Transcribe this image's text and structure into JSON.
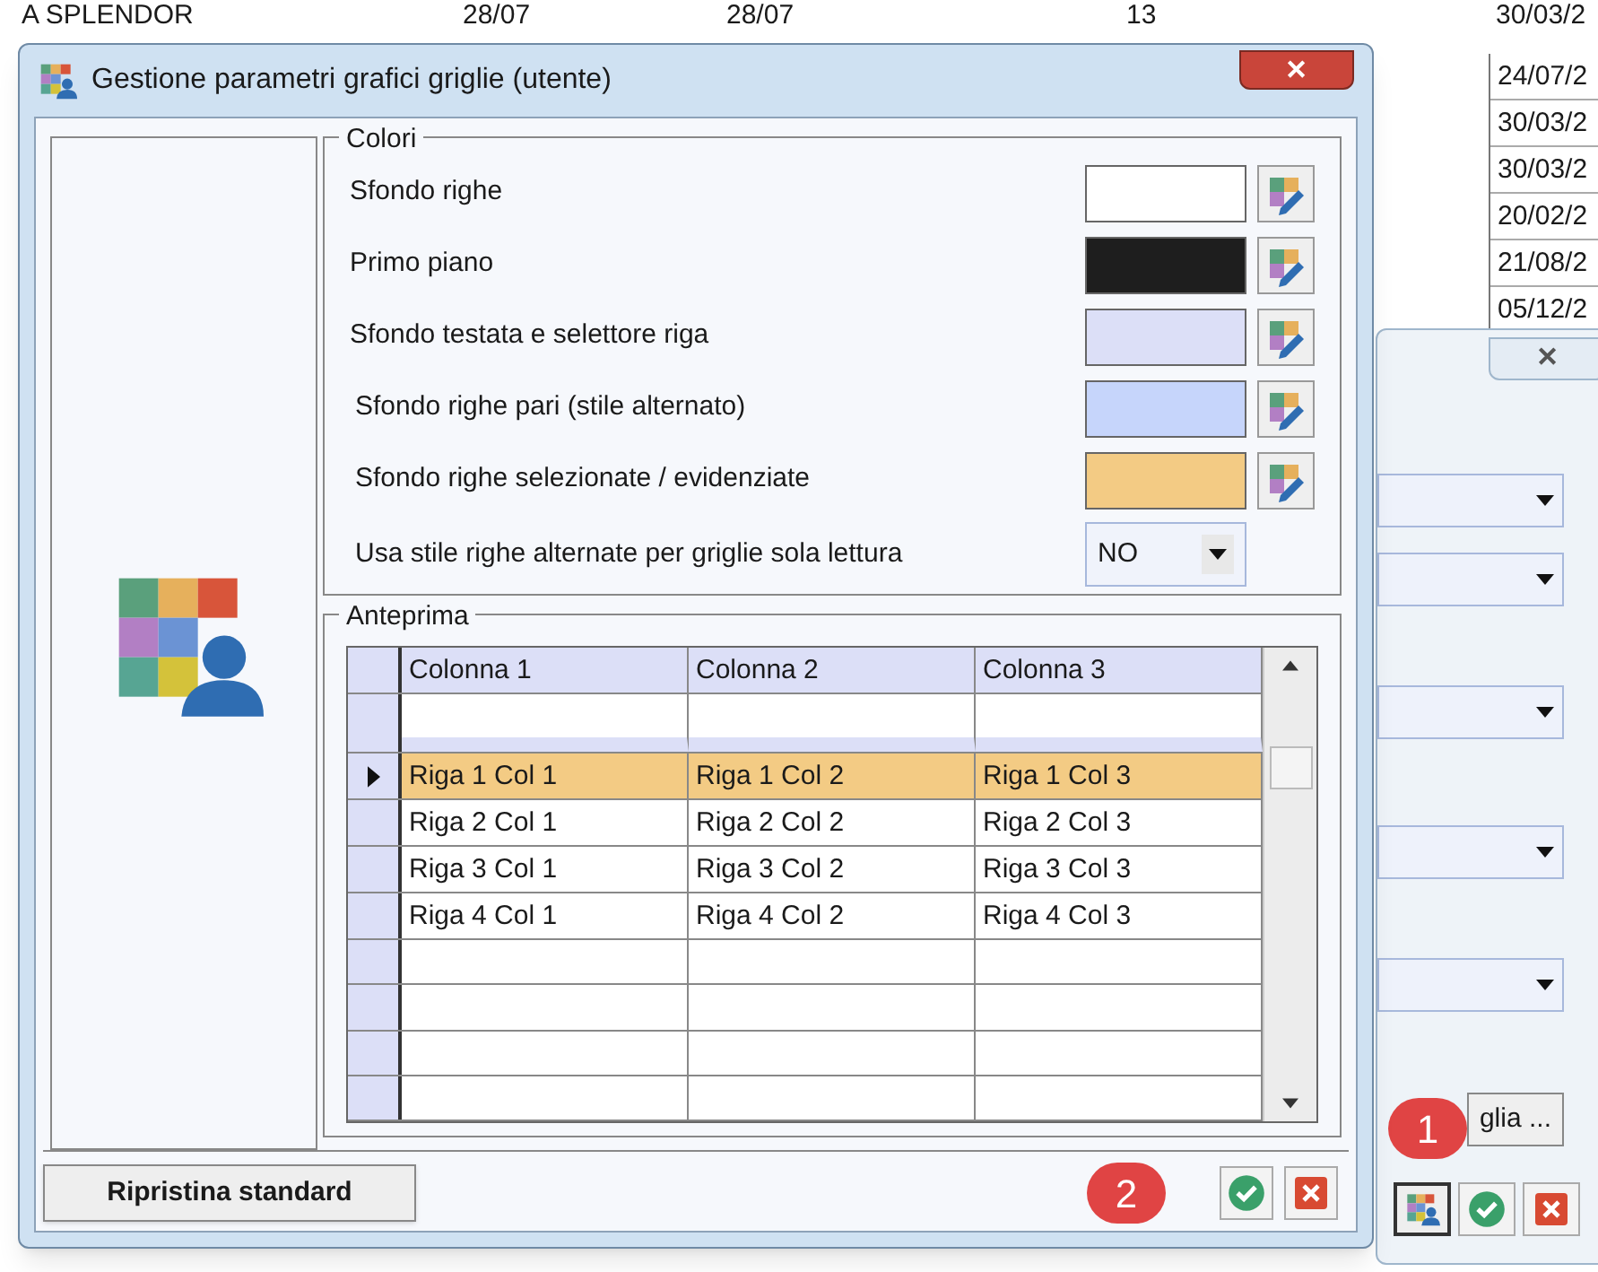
{
  "background_table": {
    "first_row": [
      "A SPLENDOR",
      "28/07",
      "28/07",
      "13",
      "30/03/2"
    ],
    "dates": [
      "24/07/2",
      "30/03/2",
      "30/03/2",
      "20/02/2",
      "21/08/2",
      "05/12/2"
    ]
  },
  "background_dialog": {
    "close": "✕",
    "button": "glia ...",
    "badge": "1"
  },
  "window": {
    "title": "Gestione parametri grafici griglie (utente)",
    "close": "✕"
  },
  "colors": {
    "title": "Colori",
    "items": [
      {
        "label": "Sfondo righe",
        "color": "#ffffff"
      },
      {
        "label": "Primo piano",
        "color": "#1e1e1e"
      },
      {
        "label": "Sfondo testata e selettore riga",
        "color": "#dcdff7"
      },
      {
        "label": "Sfondo righe pari (stile alternato)",
        "color": "#c6d5fb"
      },
      {
        "label": "Sfondo righe selezionate / evidenziate",
        "color": "#f3cb84"
      }
    ],
    "alternate": {
      "label": "Usa stile righe alternate per griglie sola lettura",
      "value": "NO"
    }
  },
  "preview": {
    "title": "Anteprima",
    "columns": [
      "Colonna 1",
      "Colonna 2",
      "Colonna 3"
    ],
    "rows": [
      {
        "cells": [
          "Riga 1 Col 1",
          "Riga 1 Col 2",
          "Riga 1 Col 3"
        ],
        "selected": true
      },
      {
        "cells": [
          "Riga 2 Col 1",
          "Riga 2 Col 2",
          "Riga 2 Col 3"
        ],
        "selected": false
      },
      {
        "cells": [
          "Riga 3 Col 1",
          "Riga 3 Col 2",
          "Riga 3 Col 3"
        ],
        "selected": false
      },
      {
        "cells": [
          "Riga 4 Col 1",
          "Riga 4 Col 2",
          "Riga 4 Col 3"
        ],
        "selected": false
      }
    ]
  },
  "footer": {
    "reset": "Ripristina standard",
    "badge": "2"
  }
}
